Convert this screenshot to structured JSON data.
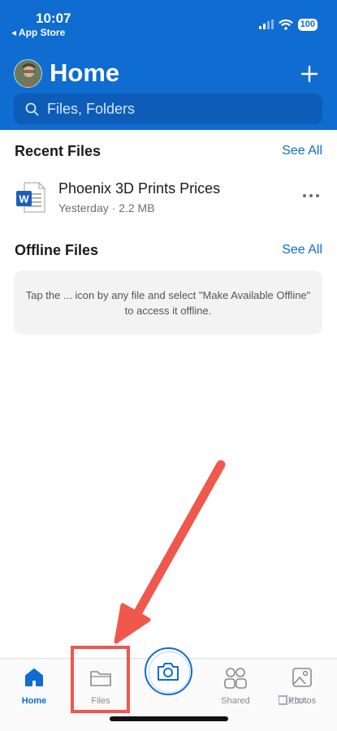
{
  "status": {
    "time": "10:07",
    "back_label": "◂ App Store",
    "battery": "100"
  },
  "header": {
    "title": "Home",
    "search_placeholder": "Files, Folders"
  },
  "recent": {
    "title": "Recent Files",
    "see_all": "See All",
    "files": [
      {
        "name": "Phoenix 3D Prints Prices",
        "meta": "Yesterday · 2.2 MB",
        "type_icon": "word-doc-icon"
      }
    ]
  },
  "offline": {
    "title": "Offline Files",
    "see_all": "See All",
    "message": "Tap the ... icon by any file and select \"Make Available Offline\" to access it offline."
  },
  "tabs": [
    {
      "label": "Home",
      "icon": "home-icon",
      "active": true
    },
    {
      "label": "Files",
      "icon": "folder-icon",
      "active": false
    },
    {
      "label": "Shared",
      "icon": "shared-icon",
      "active": false
    },
    {
      "label": "Photos",
      "icon": "photos-icon",
      "active": false
    }
  ],
  "colors": {
    "brand": "#0f6cd0",
    "highlight": "#f0574d"
  }
}
